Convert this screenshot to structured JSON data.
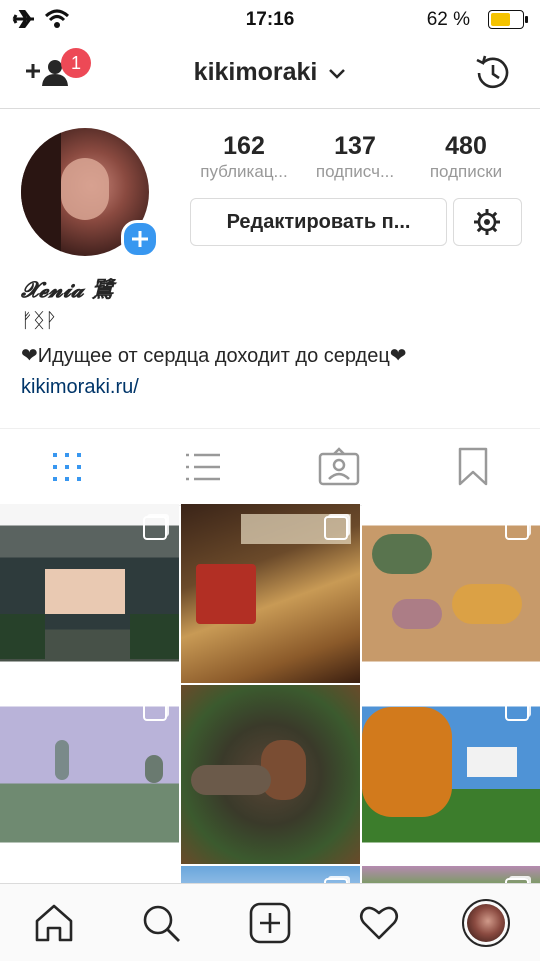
{
  "status_bar": {
    "time": "17:16",
    "battery_percent": "62 %",
    "battery_level": 0.62
  },
  "nav": {
    "username": "kikimoraki",
    "notification_count": "1"
  },
  "profile": {
    "stats": [
      {
        "value": "162",
        "label": "публикац..."
      },
      {
        "value": "137",
        "label": "подписч..."
      },
      {
        "value": "480",
        "label": "подписки"
      }
    ],
    "edit_button_label": "Редактировать п...",
    "display_name": "𝓧𝓮𝓷𝓲𝓪 鷺",
    "runes": "ᚠᛝᚹ",
    "bio": "❤Идущее от сердца доходит до сердец❤",
    "website": "kikimoraki.ru/"
  },
  "colors": {
    "accent": "#3897f0",
    "badge": "#ed4956",
    "link": "#003569",
    "text": "#262626"
  },
  "icons": {
    "nav_left": "add-person-icon",
    "nav_right": "archive-history-icon",
    "tabs": [
      "grid-icon",
      "list-icon",
      "tagged-icon",
      "saved-icon"
    ],
    "tabbar": [
      "home-icon",
      "search-icon",
      "new-post-icon",
      "activity-heart-icon",
      "profile-avatar"
    ]
  }
}
